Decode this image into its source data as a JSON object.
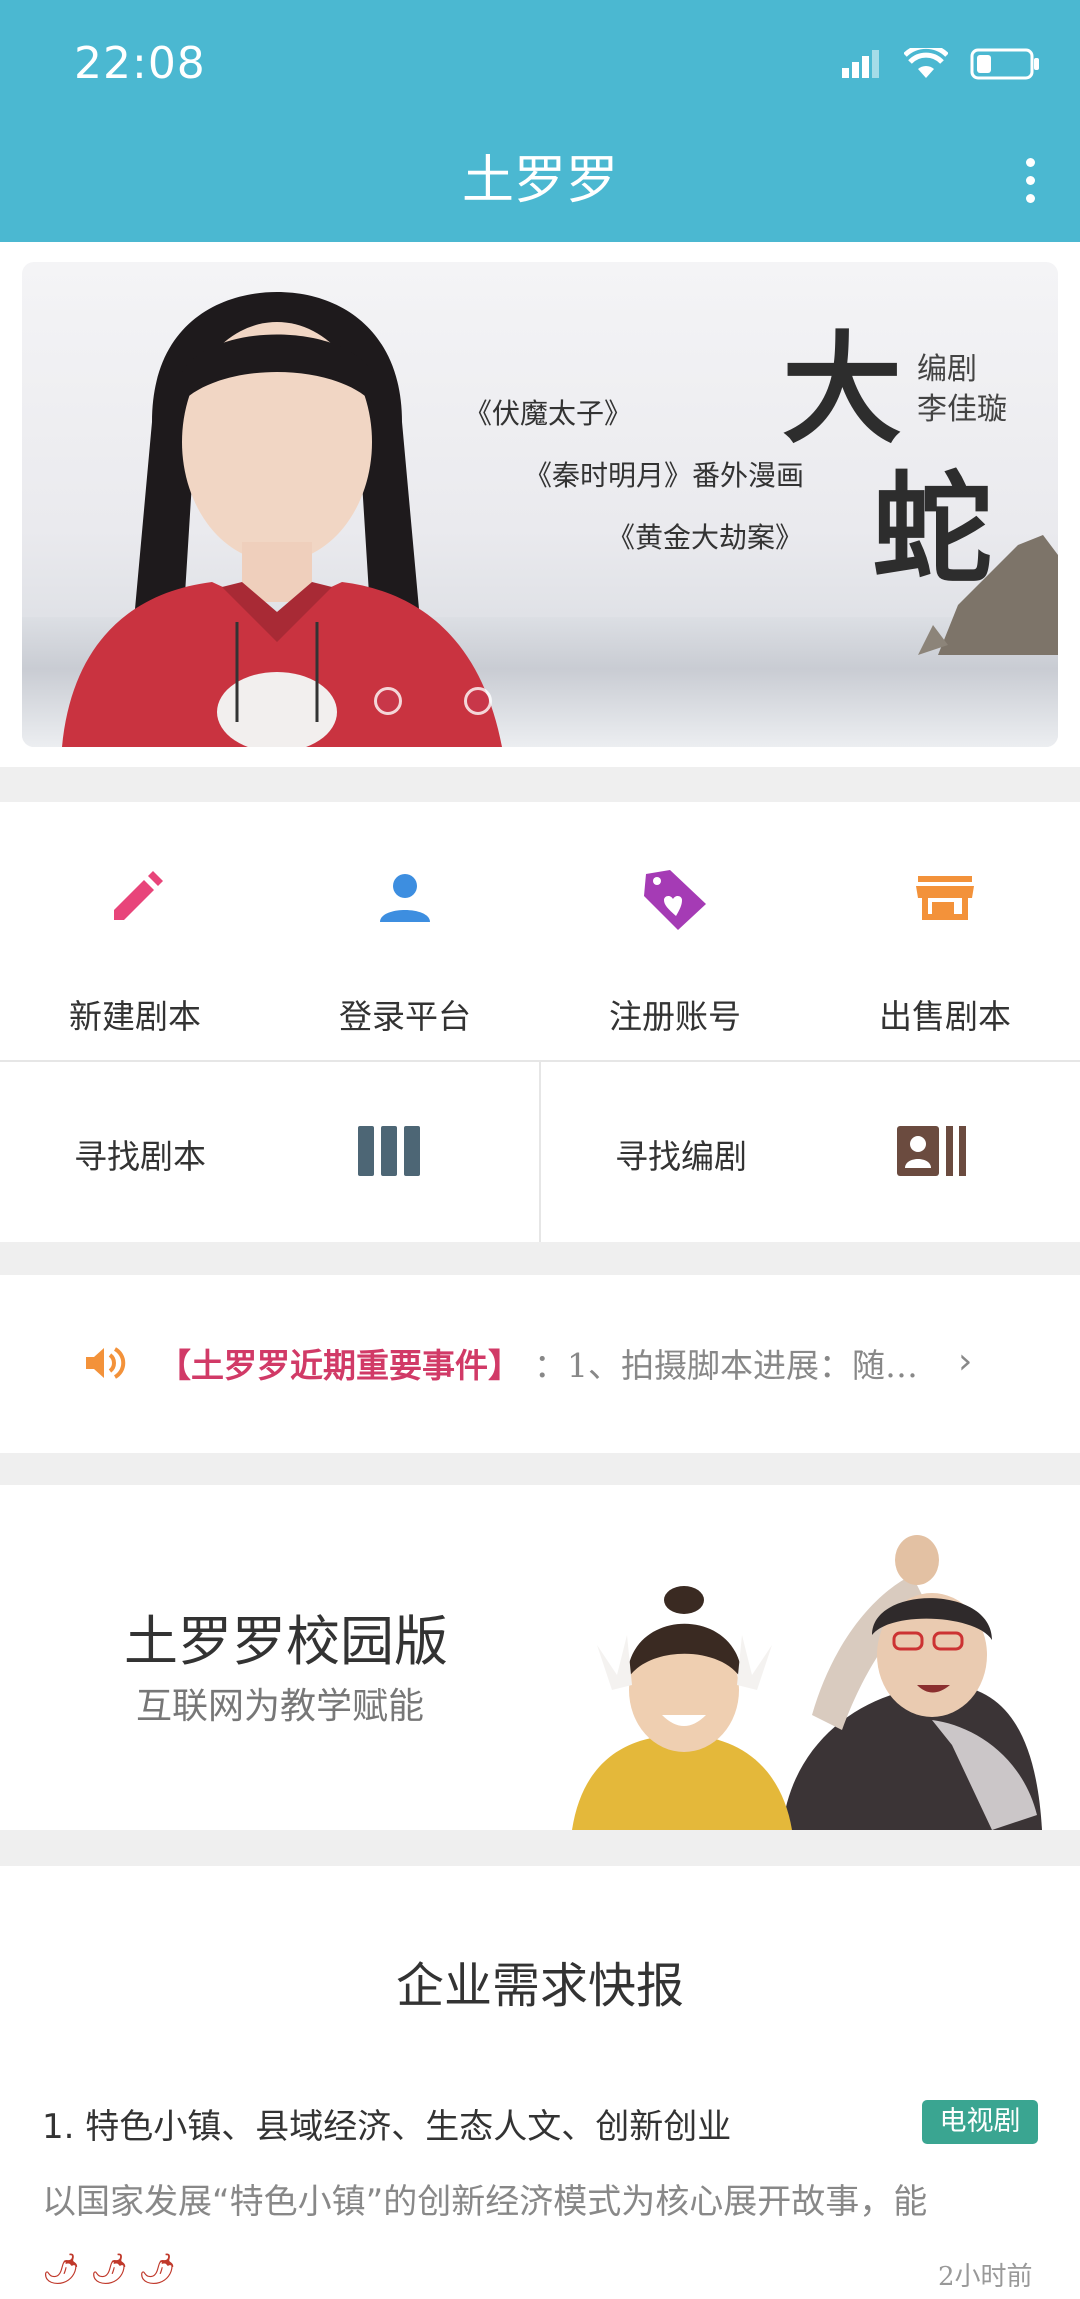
{
  "status_bar": {
    "time": "22:08"
  },
  "app_bar": {
    "title": "土罗罗"
  },
  "banner": {
    "big_char_1": "大",
    "big_char_2": "蛇",
    "credit_line1": "编剧",
    "credit_line2": "李佳璇",
    "works": [
      "《伏魔太子》",
      "《秦时明月》番外漫画",
      "《黄金大劫案》"
    ]
  },
  "quick_actions": [
    {
      "label": "新建剧本",
      "icon": "pencil-icon",
      "color": "#e8457a"
    },
    {
      "label": "登录平台",
      "icon": "person-icon",
      "color": "#3d8ee0"
    },
    {
      "label": "注册账号",
      "icon": "tag-heart-icon",
      "color": "#a53bb5"
    },
    {
      "label": "出售剧本",
      "icon": "store-icon",
      "color": "#f3923a"
    }
  ],
  "find_links": [
    {
      "label": "寻找剧本",
      "icon": "columns-icon",
      "color": "#4d6675"
    },
    {
      "label": "寻找编剧",
      "icon": "contact-card-icon",
      "color": "#6b4b3f"
    }
  ],
  "notice": {
    "title": "【土罗罗近期重要事件】",
    "text": "：1、拍摄脚本进展：随…"
  },
  "campus": {
    "title": "土罗罗校园版",
    "subtitle": "互联网为教学赋能"
  },
  "news": {
    "heading": "企业需求快报",
    "items": [
      {
        "title": "1. 特色小镇、县域经济、生态人文、创新创业",
        "tag": "电视剧",
        "description": "以国家发展“特色小镇”的创新经济模式为核心展开故事，能",
        "rating": "🌶🌶🌶",
        "time": "2小时前"
      }
    ]
  },
  "colors": {
    "primary": "#4bb8d1",
    "notice_title": "#d13a67",
    "tag_bg": "#3aa591"
  }
}
